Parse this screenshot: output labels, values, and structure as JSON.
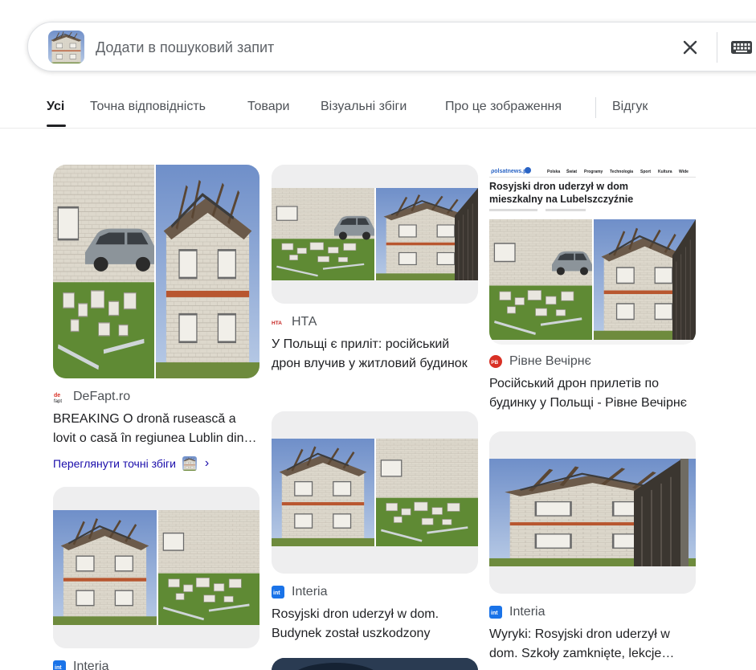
{
  "search": {
    "placeholder": "Додати в пошуковий запит",
    "value": ""
  },
  "tabs": [
    {
      "label": "Усі",
      "active": true
    },
    {
      "label": "Точна відповідність",
      "active": false
    },
    {
      "label": "Товари",
      "active": false
    },
    {
      "label": "Візуальні збіги",
      "active": false
    },
    {
      "label": "Про це зображення",
      "active": false
    },
    {
      "label": "Відгук",
      "active": false
    }
  ],
  "results": [
    {
      "source": "DeFapt.ro",
      "title": "BREAKING O dronă rusească a lovit o casă în regiunea Lublin din Polonia",
      "exact_matches_label": "Переглянути точні збіги",
      "favicon_text": "de"
    },
    {
      "source": "НТА",
      "title": "У Польщі є приліт: російський дрон влучив у житловий будинок",
      "favicon_text": "НТА"
    },
    {
      "source": "Рівне Вечірнє",
      "title": "Російський дрон прилетів по будинку у Польщі - Рівне Вечірнє",
      "favicon_text": "РВ"
    },
    {
      "source": "Interia",
      "title": "Rosyjski dron uderzył w dom. Budynek został uszkodzony",
      "favicon_text": "int"
    },
    {
      "source": "Interia",
      "title": "Wyryki: Rosyjski dron uderzył w dom. Szkoły zamknięte, lekcje zdalne",
      "favicon_text": "int"
    },
    {
      "source": "Interia",
      "title": "",
      "favicon_text": "int"
    }
  ],
  "screenshot_article": {
    "site": "polsatnews.pl",
    "nav": [
      "Polska",
      "Świat",
      "Programy",
      "Technologia",
      "Sport",
      "Kultura",
      "Wide"
    ],
    "headline_line1": "Rosyjski dron uderzył w dom",
    "headline_line2": "mieszkalny na Lubelszczyźnie"
  },
  "colors": {
    "link": "#1a0dab",
    "text": "#202124",
    "secondary": "#4d5156",
    "interia": "#1a73e8",
    "rivne": "#d93025",
    "nta": "#c5221f"
  }
}
